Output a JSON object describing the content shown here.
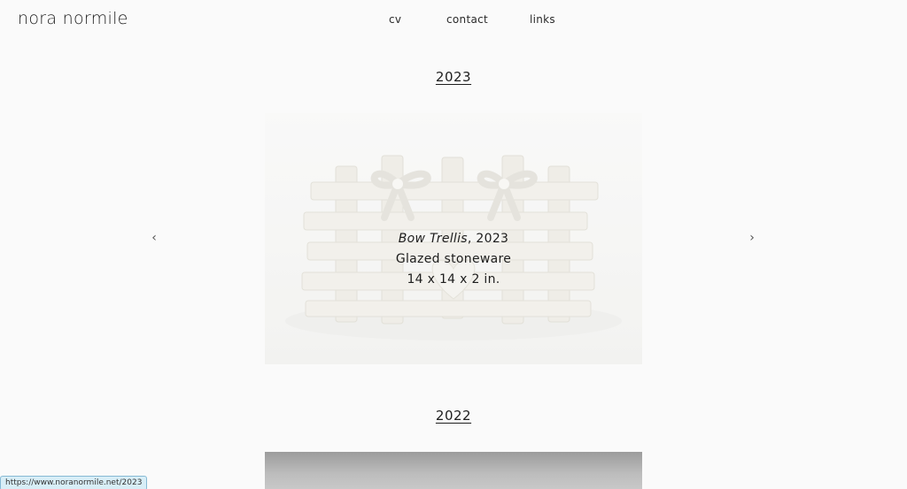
{
  "site": {
    "title": "nora normile"
  },
  "nav": {
    "items": [
      "cv",
      "contact",
      "links"
    ]
  },
  "sections": [
    {
      "year": "2023"
    },
    {
      "year": "2022"
    }
  ],
  "slideshow": {
    "prev_glyph": "‹",
    "next_glyph": "›",
    "caption": {
      "title": "Bow Trellis",
      "year_suffix": ", 2023",
      "medium": "Glazed stoneware",
      "dimensions": "14 x 14 x 2 in."
    }
  },
  "status_bar": {
    "url": "https://www.noranormile.net/2023"
  },
  "icons": {
    "prev": "chevron-left-icon",
    "next": "chevron-right-icon"
  },
  "colors": {
    "background": "#fafafa",
    "text": "#1a1a1a",
    "status_bg": "#d8eef7"
  }
}
